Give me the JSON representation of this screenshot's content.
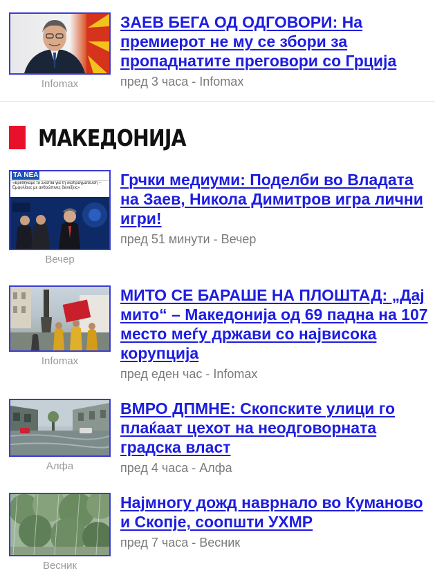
{
  "section": {
    "title": "МАКЕДОНИЈА",
    "accent": "#e8102a"
  },
  "colors": {
    "link": "#1d1de0",
    "thumb_border": "#3b3bd6",
    "meta": "#7a7a7a"
  },
  "articles": [
    {
      "title": "ЗАЕВ БЕГА ОД ОДГОВОРИ: На премиерот не му се збори за пропаднатите преговори со Грција",
      "meta": "пред 3 часа - Infomax",
      "thumb_caption": "Infomax",
      "image": "portrait-photo"
    },
    {
      "title": "Грчки медиуми: Поделби во Владата на Заев, Никола Димитров игра лични игри!",
      "meta": "пред 51 минути - Вечер",
      "thumb_caption": "Вечер",
      "image": "news-screenshot",
      "thumb_header": "ΤΑ ΝΕΑ",
      "thumb_text": "«Βρεθήκαμε το Σκοπία για τη διαπραγμάτευση – Εμφυλίους με ανθρώπινες διενέξεις»"
    },
    {
      "title": "МИТО СЕ БАРАШЕ НА ПЛОШТАД: „Дај мито“ – Македонија од 69 падна на 107 место меѓу држави со највисока корупција",
      "meta": "пред еден час - Infomax",
      "thumb_caption": "Infomax",
      "image": "square-protest-photo"
    },
    {
      "title": "ВМРО ДПМНЕ: Скопските улици го плаќаат цехот на неодговорната градска власт",
      "meta": "пред 4 часа - Алфа",
      "thumb_caption": "Алфа",
      "image": "flooded-street-photo"
    },
    {
      "title": "Најмногу дожд наврнало во Куманово и Скопје, соопшти УХМР",
      "meta": "пред 7 часа - Весник",
      "thumb_caption": "Весник",
      "image": "rain-trees-photo"
    }
  ]
}
